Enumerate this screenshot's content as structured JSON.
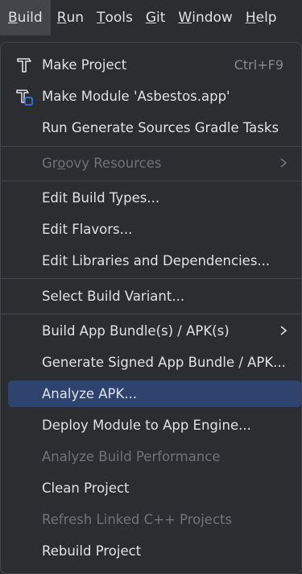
{
  "menubar": {
    "items": [
      {
        "mnemonic": "B",
        "rest": "uild"
      },
      {
        "mnemonic": "R",
        "rest": "un"
      },
      {
        "mnemonic": "T",
        "rest": "ools"
      },
      {
        "mnemonic": "G",
        "rest": "it"
      },
      {
        "mnemonic": "W",
        "rest": "indow"
      },
      {
        "mnemonic": "H",
        "rest": "elp"
      }
    ]
  },
  "build_menu": {
    "make_project": {
      "label": "Make Project",
      "shortcut": "Ctrl+F9",
      "icon": "hammer-icon"
    },
    "make_module": {
      "label": "Make Module 'Asbestos.app'",
      "icon": "hammer-module-icon"
    },
    "run_generate_sources": {
      "label": "Run Generate Sources Gradle Tasks"
    },
    "groovy_resources": {
      "label_pre": "Gr",
      "label_mn": "o",
      "label_post": "ovy Resources",
      "disabled": true
    },
    "edit_build_types": {
      "label": "Edit Build Types..."
    },
    "edit_flavors": {
      "label": "Edit Flavors..."
    },
    "edit_libraries": {
      "label": "Edit Libraries and Dependencies..."
    },
    "select_build_variant": {
      "label": "Select Build Variant..."
    },
    "build_bundle_apk": {
      "label": "Build App Bundle(s) / APK(s)"
    },
    "generate_signed": {
      "label": "Generate Signed App Bundle / APK..."
    },
    "analyze_apk": {
      "label": "Analyze APK...",
      "selected": true
    },
    "deploy_module": {
      "label": "Deploy Module to App Engine..."
    },
    "analyze_build_perf": {
      "label": "Analyze Build Performance",
      "disabled": true
    },
    "clean_project": {
      "label": "Clean Project"
    },
    "refresh_cpp": {
      "label": "Refresh Linked C++ Projects",
      "disabled": true
    },
    "rebuild_project": {
      "label": "Rebuild Project"
    }
  },
  "colors": {
    "background": "#2b2d30",
    "selected": "#2e436e",
    "text": "#dfe1e5",
    "disabled_text": "#6f737a",
    "icon_accent": "#3574f0"
  }
}
